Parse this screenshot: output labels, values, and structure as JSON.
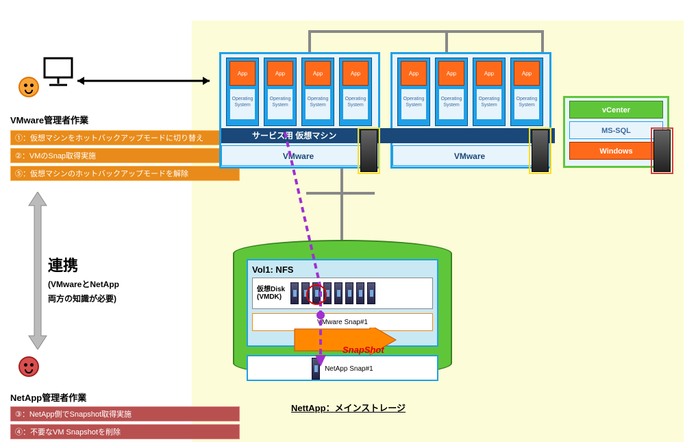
{
  "diagram": {
    "vmware_admin_label": "VMware管理者作業",
    "netapp_admin_label": "NetApp管理者作業",
    "cooperation": {
      "main": "連携",
      "sub1": "(VMwareとNetApp",
      "sub2": "両方の知識が必要)"
    },
    "tasks": {
      "t1": "①：仮想マシンをホットバックアップモードに切り替え",
      "t2": "②：VMのSnap取得実施",
      "t5": "⑤：仮想マシンのホットバックアップモードを解除",
      "t3": "③：NetApp側でSnapshot取得実施",
      "t4": "④：不要なVM Snapshotを削除"
    },
    "vm": {
      "app": "App",
      "os1": "Operating",
      "os2": "System"
    },
    "service_bar": "サービス用 仮想マシン",
    "vmware_bar": "VMware",
    "mgmt": {
      "vcenter": "vCenter",
      "mssql": "MS-SQL",
      "windows": "Windows"
    },
    "storage": {
      "vol": "Vol1: NFS",
      "vmdk1": "仮想Disk",
      "vmdk2": "(VMDK)",
      "vmsnap": "VMware Snap#1",
      "netappsnap": "NetApp Snap#1",
      "label": "NettApp：メインストレージ",
      "snapshot": "SnapShot"
    }
  }
}
